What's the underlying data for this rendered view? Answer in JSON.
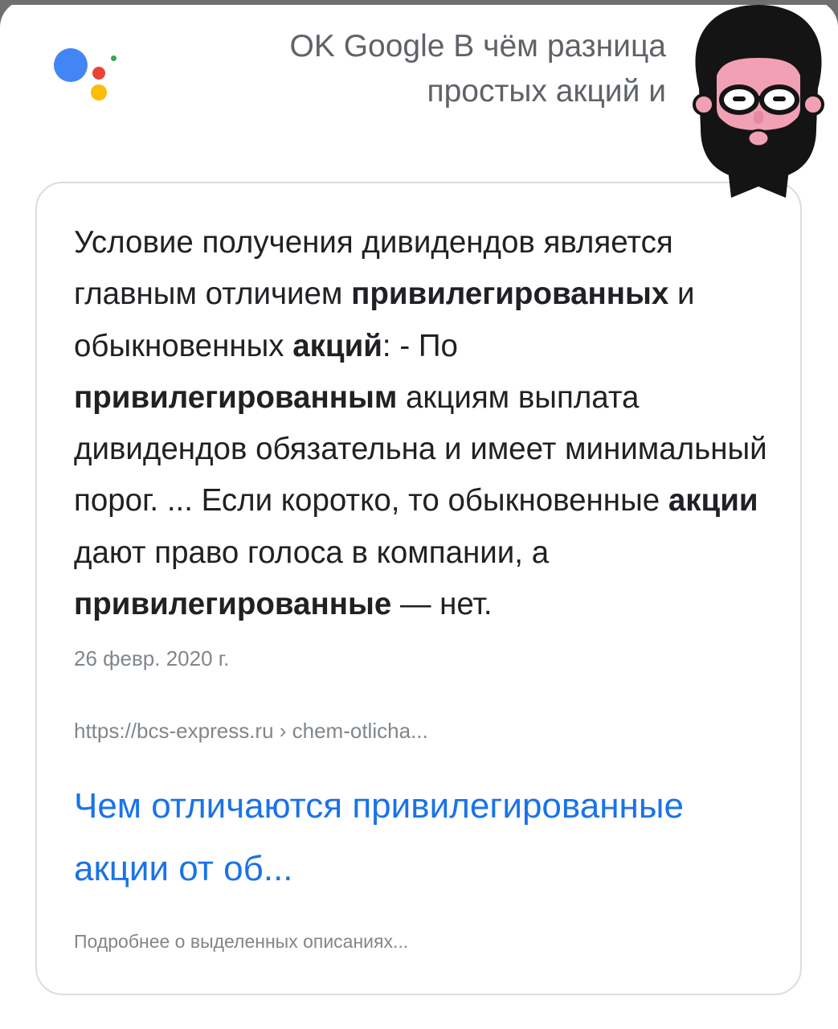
{
  "assistant": {
    "query_line1": "OK Google В чём разница",
    "query_line2": "простых акций и"
  },
  "featured_snippet": {
    "segments": [
      {
        "text": "Условие получения дивидендов является главным отличием ",
        "bold": false
      },
      {
        "text": "привилегированных",
        "bold": true
      },
      {
        "text": " и обыкновенных ",
        "bold": false
      },
      {
        "text": "акций",
        "bold": true
      },
      {
        "text": ": - По ",
        "bold": false
      },
      {
        "text": "привилегированным",
        "bold": true
      },
      {
        "text": " акциям выплата дивидендов обязательна и имеет минимальный порог. ... Если коротко, то обыкновенные ",
        "bold": false
      },
      {
        "text": "акции",
        "bold": true
      },
      {
        "text": " дают право голоса в компании, а ",
        "bold": false
      },
      {
        "text": "привилегированные",
        "bold": true
      },
      {
        "text": " — нет.",
        "bold": false
      }
    ],
    "date": "26 февр. 2020 г.",
    "source_url": "https://bcs-express.ru › chem-otlicha...",
    "result_title": "Чем отличаются привилегированные акции от об...",
    "more_info": "Подробнее о выделенных описаниях..."
  },
  "colors": {
    "link": "#1a73e8",
    "google_blue": "#4285f4",
    "google_red": "#ea4335",
    "google_yellow": "#fbbc05",
    "google_green": "#34a853"
  },
  "icons": {
    "assistant_logo": "google-assistant-icon",
    "avatar": "bearded-man-with-glasses-avatar"
  }
}
